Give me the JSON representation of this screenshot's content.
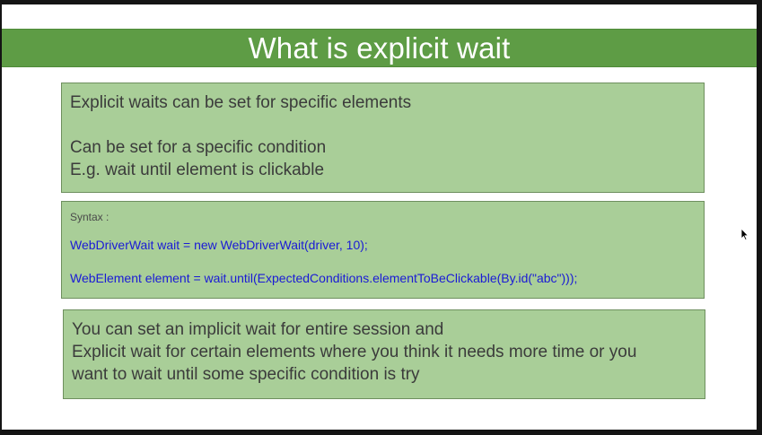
{
  "slide": {
    "title": "What is explicit wait"
  },
  "box1": {
    "lines": [
      "Explicit waits can be set for specific elements",
      "Can be set for a specific condition",
      "E.g. wait until element is clickable"
    ]
  },
  "box2": {
    "label": "Syntax :",
    "code": [
      "WebDriverWait wait = new WebDriverWait(driver, 10);",
      "WebElement element = wait.until(ExpectedConditions.elementToBeClickable(By.id(\"abc\")));"
    ]
  },
  "box3": {
    "lines": [
      "You can set an implicit wait for entire session and",
      "Explicit wait for certain elements where you think it needs more time or you",
      "want to wait until some specific condition is try"
    ]
  },
  "colors": {
    "title_bar": "#5e9c45",
    "box_fill": "#a9ce98",
    "code_text": "#1a1ad6",
    "body_text": "#3b3b3b"
  },
  "icons": {
    "cursor": "mouse-pointer-icon"
  }
}
